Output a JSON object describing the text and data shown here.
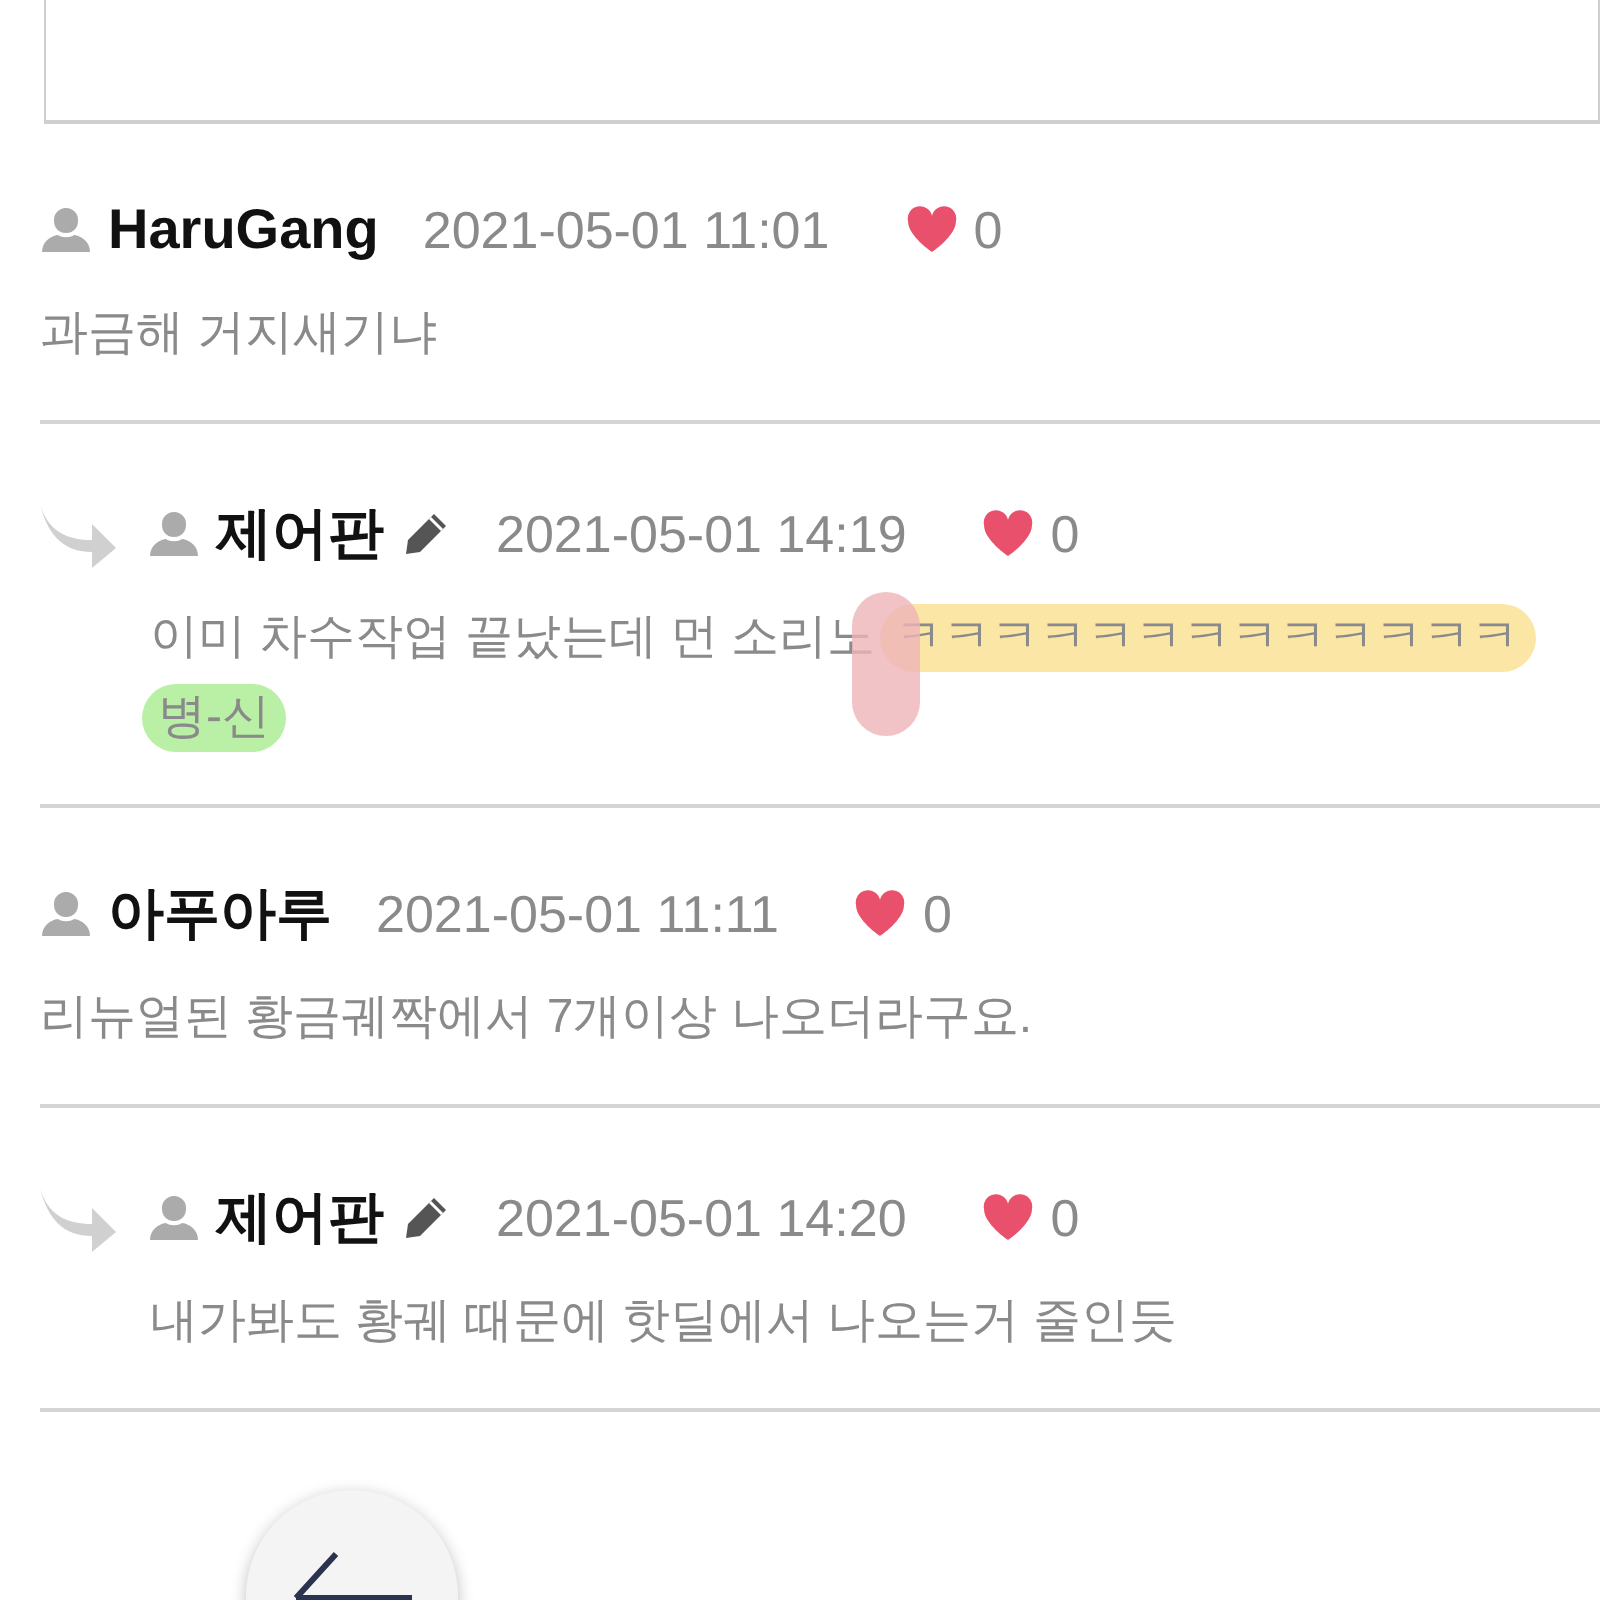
{
  "comment_box": {
    "kind": "textarea"
  },
  "comments": [
    {
      "kind": "comment",
      "author": "HaruGang",
      "edited": false,
      "date": "2021-05-01 11:01",
      "likes": "0",
      "lines": [
        [
          {
            "text": "과금해 거지새기냐"
          }
        ]
      ]
    },
    {
      "kind": "reply",
      "author": "제어판",
      "edited": true,
      "date": "2021-05-01 14:19",
      "likes": "0",
      "pen_mark": {
        "color": "#eeb4b8"
      },
      "lines": [
        [
          {
            "text": "이미 차수작업 끝났는데 먼 소리노"
          },
          {
            "text": "ㅋㅋㅋㅋㅋㅋㅋㅋㅋㅋㅋㅋㅋ",
            "color": "#fbe6a6"
          }
        ],
        [
          {
            "text": "병-신",
            "color": "#b9f0a6"
          }
        ]
      ]
    },
    {
      "kind": "comment",
      "author": "아푸아루",
      "edited": false,
      "date": "2021-05-01 11:11",
      "likes": "0",
      "lines": [
        [
          {
            "text": "리뉴얼된 황금궤짝에서 7개이상 나오더라구요."
          }
        ]
      ]
    },
    {
      "kind": "reply",
      "author": "제어판",
      "edited": true,
      "date": "2021-05-01 14:20",
      "likes": "0",
      "lines": [
        [
          {
            "text": "내가봐도 황궤 때문에 핫딜에서 나오는거 줄인듯"
          }
        ]
      ]
    }
  ],
  "back_button": {
    "kind": "round"
  }
}
